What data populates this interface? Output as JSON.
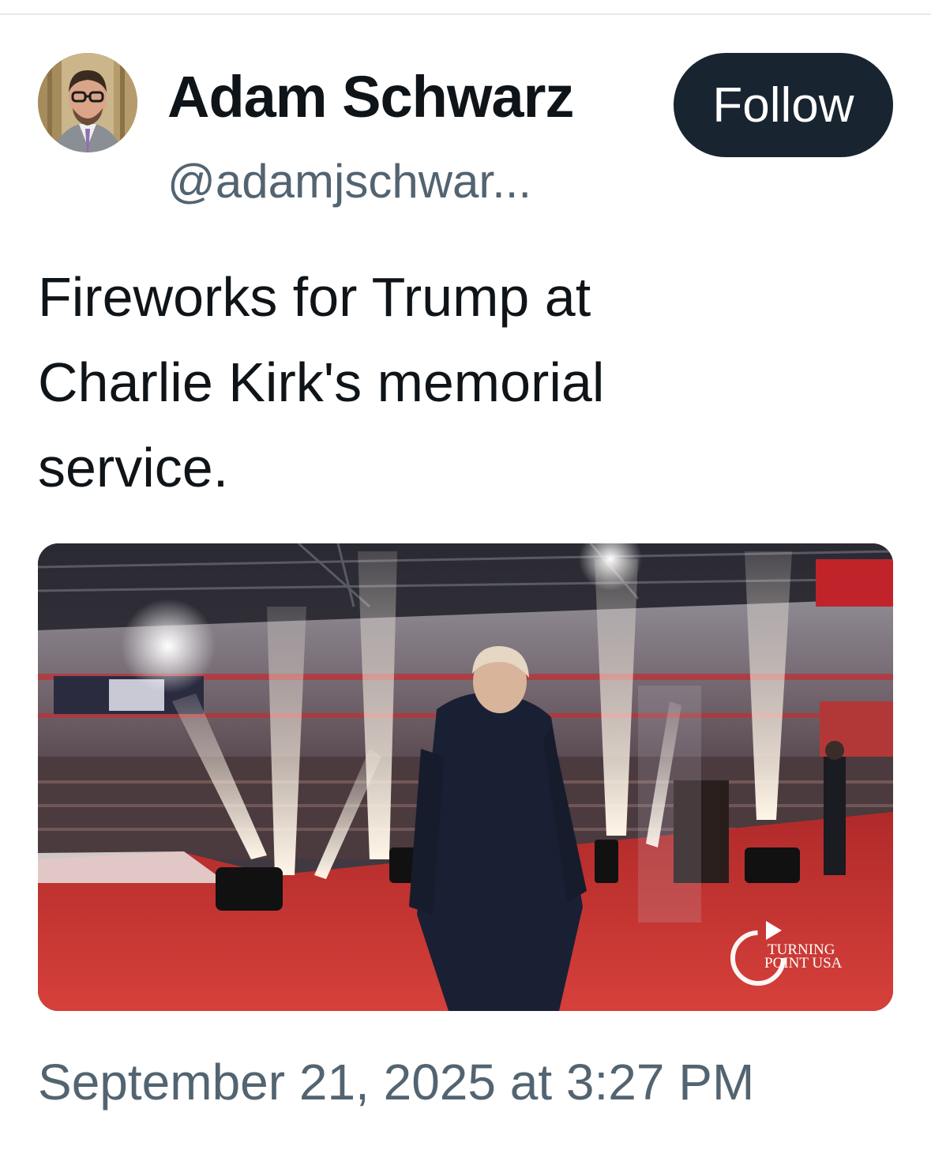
{
  "author": {
    "display_name": "Adam Schwarz",
    "handle": "@adamjschwar...",
    "follow_label": "Follow"
  },
  "tweet": {
    "text_lines": [
      "Fireworks for Trump at",
      "Charlie Kirk's memorial",
      "service."
    ],
    "timestamp": "September 21, 2025 at 3:27 PM"
  },
  "media": {
    "watermark_line1": "TURNING",
    "watermark_line2": "POINT USA",
    "stage_color": "#c6322e",
    "spark_color": "#fff6e8"
  },
  "colors": {
    "text": "#0f1419",
    "secondary": "#536471",
    "button_bg": "#18242f"
  }
}
